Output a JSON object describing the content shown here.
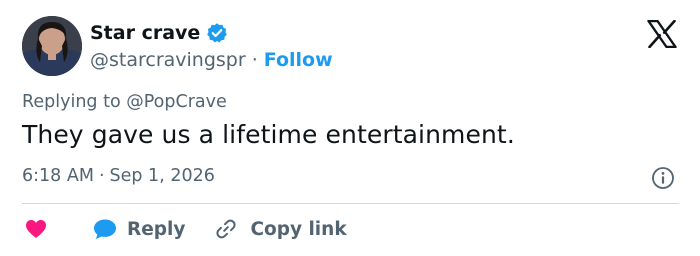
{
  "author": {
    "display_name": "Star crave",
    "handle": "@starcravingspr",
    "separator": "·",
    "follow_label": "Follow",
    "verified": true
  },
  "reply_context": {
    "prefix": "Replying to",
    "mention": "@PopCrave"
  },
  "tweet": {
    "text": "They gave us a lifetime entertainment.",
    "time": "6:18 AM",
    "separator": "·",
    "date": "Sep 1, 2026"
  },
  "actions": {
    "reply_label": "Reply",
    "copy_link_label": "Copy link"
  },
  "icons": {
    "like": "heart-icon",
    "reply": "speech-bubble-icon",
    "copy": "link-icon",
    "info": "info-icon",
    "brand": "x-logo-icon",
    "verified": "verified-badge-icon"
  },
  "colors": {
    "accent": "#1d9bf0",
    "like": "#f91880",
    "text_primary": "#0f1419",
    "text_secondary": "#536471",
    "divider": "#cfd9de"
  }
}
